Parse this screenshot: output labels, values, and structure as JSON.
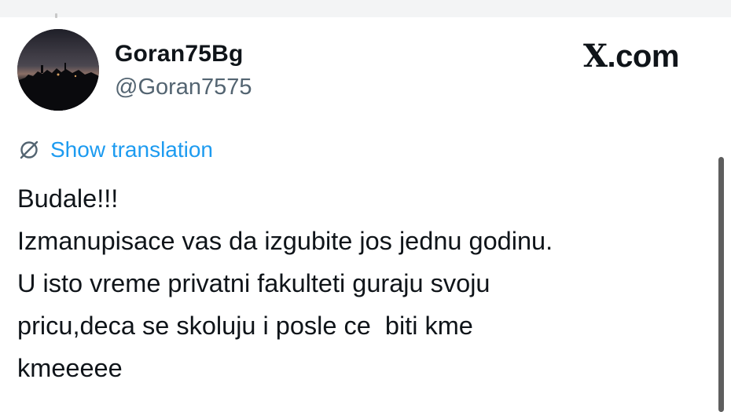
{
  "author": {
    "name": "Goran75Bg",
    "handle": "@Goran7575",
    "avatar_icon": "avatar-photo"
  },
  "brand": {
    "logo_text": "X",
    "suffix_text": ".com"
  },
  "translation": {
    "icon": "globe-slash-icon",
    "label": "Show translation",
    "color": "#1d9bf0"
  },
  "tweet": {
    "lines": [
      "Budale!!!",
      "Izmanupisace vas da izgubite jos jednu godinu.",
      "U isto vreme privatni fakulteti guraju svoju",
      "pricu,deca se skoluju i posle ce  biti kme",
      "kmeeeee"
    ]
  },
  "colors": {
    "text": "#0f1419",
    "secondary_text": "#536471",
    "link": "#1d9bf0",
    "background": "#ffffff"
  }
}
